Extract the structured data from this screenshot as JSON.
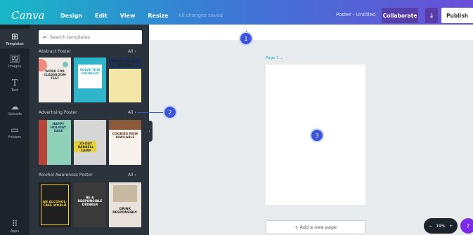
{
  "topbar": {
    "logo": "Canva",
    "menu": [
      "Design",
      "Edit",
      "View",
      "Resize"
    ],
    "saved": "All changes saved",
    "doc_title": "Poster - Untitled",
    "collaborate": "Collaborate",
    "download_icon": "download-icon",
    "publish": "Publish"
  },
  "rail": [
    {
      "label": "Templates",
      "icon": "templates-icon"
    },
    {
      "label": "Images",
      "icon": "image-icon"
    },
    {
      "label": "Text",
      "icon": "text-icon"
    },
    {
      "label": "Uploads",
      "icon": "upload-icon"
    },
    {
      "label": "Folders",
      "icon": "folder-icon"
    },
    {
      "label": "Apps",
      "icon": "apps-icon"
    }
  ],
  "panel": {
    "search_placeholder": "Search templates",
    "sections": [
      {
        "title": "Abstract Poster",
        "all": "All",
        "thumbs": [
          {
            "text": "WORK FOR CLASSROOM TEST",
            "bg": "#f3ece6",
            "fg": "#333"
          },
          {
            "text": "SOLVE THIS PROBLEM",
            "bg": "#2fb4c9",
            "fg": "#fff"
          },
          {
            "text": "STORY OF ALL WOMEN",
            "bg": "#f4e6a6",
            "fg": "#222"
          }
        ]
      },
      {
        "title": "Advertising Poster",
        "all": "All",
        "thumbs": [
          {
            "text": "HAPPY HOLIDAY SALE",
            "bg": "#8fd0b8",
            "fg": "#1e3a5f"
          },
          {
            "text": "20-DAY BARBELL CAMP",
            "bg": "#d6d6d6",
            "fg": "#333"
          },
          {
            "text": "COOKIES NOW AVAILABLE",
            "bg": "#f7f3ec",
            "fg": "#5a3a2a"
          }
        ]
      },
      {
        "title": "Alcohol Awareness Poster",
        "all": "All",
        "thumbs": [
          {
            "text": "AN ALCOHOL-FREE WORLD",
            "bg": "#1f1f1f",
            "fg": "#f4d03f"
          },
          {
            "text": "BE A RESPONSIBLE DRINKER",
            "bg": "#3a3a3a",
            "fg": "#fff"
          },
          {
            "text": "DRINK RESPONSIBLY.",
            "bg": "#e8e2da",
            "fg": "#222"
          }
        ]
      }
    ]
  },
  "canvas": {
    "page_label": "Page 1",
    "add_page": "+ Add a new page"
  },
  "zoom": {
    "minus": "−",
    "value": "19%",
    "plus": "+"
  },
  "help": "?",
  "callouts": [
    "1",
    "2",
    "3"
  ],
  "colors": {
    "accent": "#1fb5c4",
    "callout": "#3b53d8",
    "panel": "#2b333c",
    "rail": "#1c232b",
    "help": "#7d2ae8"
  }
}
